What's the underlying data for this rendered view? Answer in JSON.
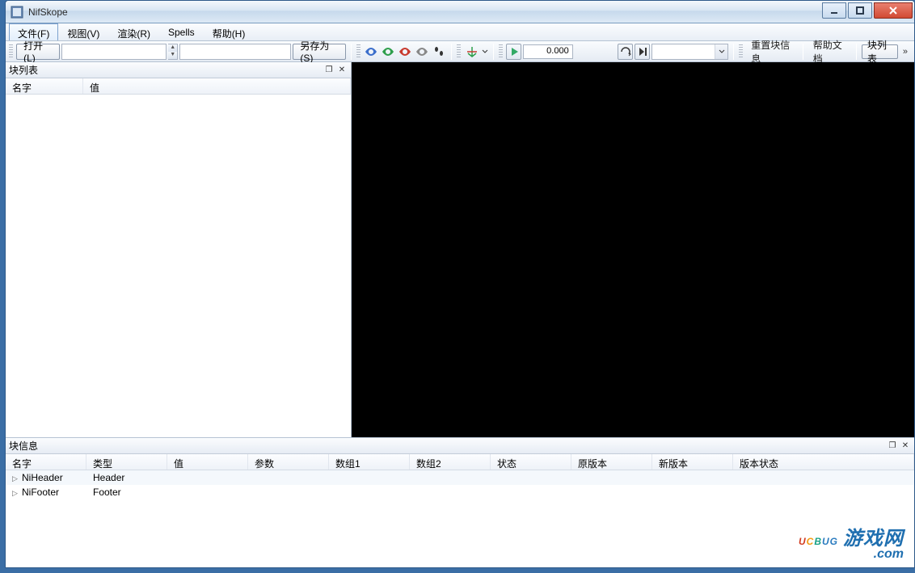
{
  "window": {
    "title": "NifSkope"
  },
  "menu": {
    "file": "文件(F)",
    "view": "视图(V)",
    "render": "渲染(R)",
    "spells": "Spells",
    "help": "帮助(H)"
  },
  "toolbar": {
    "open_label": "打开 (L)",
    "path_value": "",
    "saveas_label": "另存为 (S)",
    "time_value": "0.000",
    "reset_block_info": "重置块信息",
    "help_doc": "帮助文档",
    "block_list_btn": "块列表"
  },
  "panel_left": {
    "title": "块列表",
    "columns": {
      "name": "名字",
      "value": "值"
    }
  },
  "panel_bottom": {
    "title": "块信息",
    "columns": {
      "name": "名字",
      "type": "类型",
      "value": "值",
      "param": "参数",
      "arr1": "数组1",
      "arr2": "数组2",
      "status": "状态",
      "orig_ver": "原版本",
      "new_ver": "新版本",
      "ver_status": "版本状态"
    },
    "rows": [
      {
        "name": "NiHeader",
        "type": "Header"
      },
      {
        "name": "NiFooter",
        "type": "Footer"
      }
    ]
  },
  "watermark": {
    "brand_letters": [
      "U",
      "C",
      "B",
      "U",
      "G"
    ],
    "brand_cn": "游戏网",
    "domain": ".com"
  }
}
